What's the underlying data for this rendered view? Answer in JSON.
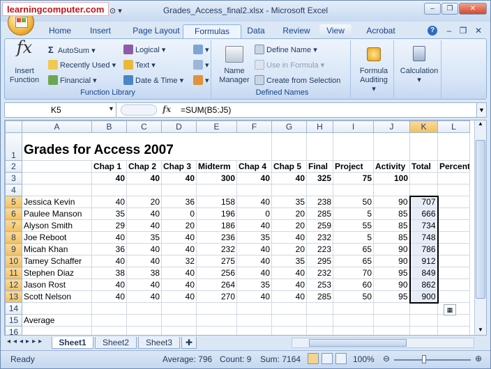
{
  "watermark": "learningcomputer.com",
  "window": {
    "title": "Grades_Access_final2.xlsx - Microsoft Excel",
    "minimize": "–",
    "restore": "❐",
    "close": "✕"
  },
  "tabs": [
    "Home",
    "Insert",
    "Page Layout",
    "Formulas",
    "Data",
    "Review",
    "View",
    "Acrobat"
  ],
  "active_tab": "Formulas",
  "ribbon": {
    "function_library": {
      "label": "Function Library",
      "insert_function": "Insert\nFunction",
      "autosum": "AutoSum",
      "recently_used": "Recently Used",
      "financial": "Financial",
      "logical": "Logical",
      "text": "Text",
      "date_time": "Date & Time"
    },
    "defined_names": {
      "label": "Defined Names",
      "name_manager": "Name\nManager",
      "define_name": "Define Name",
      "use_in_formula": "Use in Formula",
      "create_from_selection": "Create from Selection"
    },
    "formula_auditing": "Formula\nAuditing",
    "calculation": "Calculation"
  },
  "formula_bar": {
    "name_box": "K5",
    "fx": "fx",
    "formula": "=SUM(B5:J5)"
  },
  "columns": [
    "A",
    "B",
    "C",
    "D",
    "E",
    "F",
    "G",
    "H",
    "I",
    "J",
    "K",
    "L"
  ],
  "selected_column": "K",
  "row_numbers": [
    "1",
    "2",
    "3",
    "4",
    "5",
    "6",
    "7",
    "8",
    "9",
    "10",
    "11",
    "12",
    "13",
    "14",
    "15",
    "16"
  ],
  "sheet": {
    "title": "Grades for Access 2007",
    "headers": [
      "Chap 1",
      "Chap 2",
      "Chap 3",
      "Midterm",
      "Chap 4",
      "Chap 5",
      "Final",
      "Project",
      "Activity",
      "Total",
      "Percent"
    ],
    "max_points": [
      "40",
      "40",
      "40",
      "300",
      "40",
      "40",
      "325",
      "75",
      "100"
    ],
    "students": [
      {
        "name": "Jessica Kevin",
        "scores": [
          "40",
          "20",
          "36",
          "158",
          "40",
          "35",
          "238",
          "50",
          "90"
        ],
        "total": "707"
      },
      {
        "name": "Paulee Manson",
        "scores": [
          "35",
          "40",
          "0",
          "196",
          "0",
          "20",
          "285",
          "5",
          "85"
        ],
        "total": "666"
      },
      {
        "name": "Alyson Smith",
        "scores": [
          "29",
          "40",
          "20",
          "186",
          "40",
          "20",
          "259",
          "55",
          "85"
        ],
        "total": "734"
      },
      {
        "name": "Joe Reboot",
        "scores": [
          "40",
          "35",
          "40",
          "236",
          "35",
          "40",
          "232",
          "5",
          "85"
        ],
        "total": "748"
      },
      {
        "name": "Micah Khan",
        "scores": [
          "36",
          "40",
          "40",
          "232",
          "40",
          "20",
          "223",
          "65",
          "90"
        ],
        "total": "786"
      },
      {
        "name": "Tamey Schaffer",
        "scores": [
          "40",
          "40",
          "32",
          "275",
          "40",
          "35",
          "295",
          "65",
          "90"
        ],
        "total": "912"
      },
      {
        "name": "Stephen Diaz",
        "scores": [
          "38",
          "38",
          "40",
          "256",
          "40",
          "40",
          "232",
          "70",
          "95"
        ],
        "total": "849"
      },
      {
        "name": "Jason Rost",
        "scores": [
          "40",
          "40",
          "40",
          "264",
          "35",
          "40",
          "253",
          "60",
          "90"
        ],
        "total": "862"
      },
      {
        "name": "Scott Nelson",
        "scores": [
          "40",
          "40",
          "40",
          "270",
          "40",
          "40",
          "285",
          "50",
          "95"
        ],
        "total": "900"
      }
    ],
    "average_label": "Average"
  },
  "sheet_tabs": [
    "Sheet1",
    "Sheet2",
    "Sheet3"
  ],
  "active_sheet": "Sheet1",
  "status": {
    "ready": "Ready",
    "average": "Average: 796",
    "count": "Count: 9",
    "sum": "Sum: 7164",
    "zoom": "100%"
  }
}
